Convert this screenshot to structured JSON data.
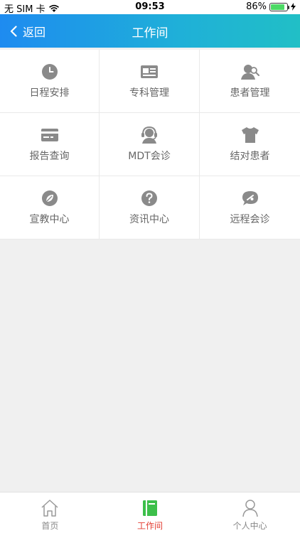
{
  "status_bar": {
    "carrier": "无 SIM 卡",
    "time": "09:53",
    "battery": "86%",
    "battery_level": 0.86
  },
  "nav": {
    "back_label": "返回",
    "title": "工作间"
  },
  "grid": [
    {
      "label": "日程安排",
      "icon": "clock-icon"
    },
    {
      "label": "专科管理",
      "icon": "id-card-icon"
    },
    {
      "label": "患者管理",
      "icon": "patient-search-icon"
    },
    {
      "label": "报告查询",
      "icon": "card-icon"
    },
    {
      "label": "MDT会诊",
      "icon": "headset-icon"
    },
    {
      "label": "结对患者",
      "icon": "shirt-icon"
    },
    {
      "label": "宣教中心",
      "icon": "leaf-icon"
    },
    {
      "label": "资讯中心",
      "icon": "question-icon"
    },
    {
      "label": "远程会诊",
      "icon": "chat-link-icon"
    }
  ],
  "tabbar": [
    {
      "label": "首页",
      "icon": "home-icon",
      "active": false
    },
    {
      "label": "工作间",
      "icon": "book-icon",
      "active": true
    },
    {
      "label": "个人中心",
      "icon": "person-icon",
      "active": false
    }
  ],
  "colors": {
    "nav_gradient_start": "#1e8bf0",
    "nav_gradient_end": "#21bfc6",
    "icon_gray": "#8a8a8a",
    "active_tab": "#e33e33",
    "active_tab_icon": "#3cbf4a"
  }
}
